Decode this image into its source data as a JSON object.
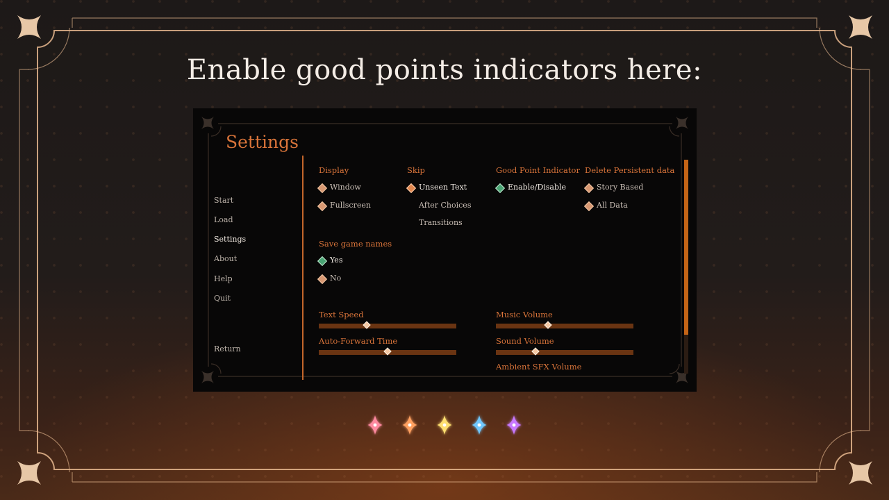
{
  "headline": "Enable good points indicators here:",
  "settings_screen": {
    "title": "Settings",
    "nav": [
      {
        "label": "Start",
        "active": false
      },
      {
        "label": "Load",
        "active": false
      },
      {
        "label": "Settings",
        "active": true
      },
      {
        "label": "About",
        "active": false
      },
      {
        "label": "Help",
        "active": false
      },
      {
        "label": "Quit",
        "active": false
      },
      {
        "label": "Return",
        "active": false
      }
    ],
    "display": {
      "heading": "Display",
      "options": [
        {
          "label": "Window",
          "selected": false
        },
        {
          "label": "Fullscreen",
          "selected": false
        }
      ]
    },
    "skip": {
      "heading": "Skip",
      "options": [
        {
          "label": "Unseen Text",
          "selected": true
        },
        {
          "label": "After Choices",
          "selected": false
        },
        {
          "label": "Transitions",
          "selected": false
        }
      ]
    },
    "good_point_indicator": {
      "heading": "Good Point Indicator",
      "options": [
        {
          "label": "Enable/Disable",
          "selected": true
        }
      ]
    },
    "delete_persistent": {
      "heading": "Delete Persistent data",
      "options": [
        {
          "label": "Story Based",
          "selected": false
        },
        {
          "label": "All Data",
          "selected": false
        }
      ]
    },
    "save_game_names": {
      "heading": "Save game names",
      "options": [
        {
          "label": "Yes",
          "selected": true
        },
        {
          "label": "No",
          "selected": false
        }
      ]
    },
    "sliders": [
      {
        "label": "Text Speed",
        "value": 0.35
      },
      {
        "label": "Music Volume",
        "value": 0.38
      },
      {
        "label": "Auto-Forward Time",
        "value": 0.5
      },
      {
        "label": "Sound Volume",
        "value": 0.29
      },
      {
        "label": "Ambient SFX Volume"
      }
    ],
    "scroll_position": 0.0
  },
  "sparkle_colors": [
    "#ff8aa0",
    "#ffa060",
    "#ffe070",
    "#6fc8ff",
    "#c879ff"
  ],
  "colors": {
    "accent": "#d9743a",
    "frame": "#e7b98f",
    "track": "#6a3412",
    "scroll": "#c56416"
  }
}
